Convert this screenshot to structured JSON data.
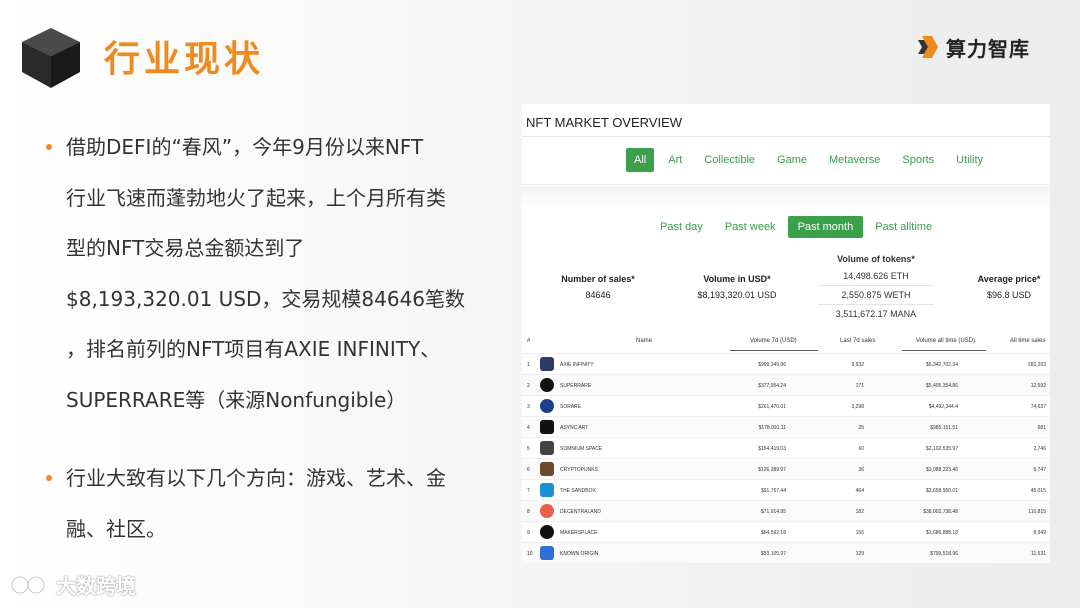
{
  "slide": {
    "title": "行业现状",
    "brand": "算力智库",
    "watermark": "大数跨境",
    "bullets": [
      {
        "lines": [
          "借助DEFI的“春风”，今年9月份以来NFT",
          "行业飞速而蓬勃地火了起来，上个月所有类",
          "型的NFT交易总金额达到了",
          "$8,193,320.01 USD，交易规模84646笔数",
          "，排名前列的NFT项目有AXIE INFINITY、",
          "SUPERRARE等（来源Nonfungible）"
        ]
      },
      {
        "lines": [
          "行业大致有以下几个方向：游戏、艺术、金",
          "融、社区。"
        ]
      }
    ]
  },
  "nft": {
    "title": "NFT MARKET OVERVIEW",
    "categories": [
      "All",
      "Art",
      "Collectible",
      "Game",
      "Metaverse",
      "Sports",
      "Utility"
    ],
    "active_category": "All",
    "periods": [
      "Past day",
      "Past week",
      "Past month",
      "Past alltime"
    ],
    "active_period": "Past month",
    "stats": {
      "sales_label": "Number of sales*",
      "sales_value": "84646",
      "volume_label": "Volume in USD*",
      "volume_value": "$8,193,320.01 USD",
      "tokens_label": "Volume of tokens*",
      "tokens_values": [
        "14,498.626 ETH",
        "2,550.875 WETH",
        "3,511,672.17 MANA"
      ],
      "avg_label": "Average price*",
      "avg_value": "$96.8 USD"
    },
    "table": {
      "headers": {
        "rank": "#",
        "name": "Name",
        "vol7": "Volume 7d (USD)",
        "sales7": "Last 7d sales",
        "volall": "Volume all time (USD)",
        "salesall": "All time sales"
      },
      "rows": [
        {
          "rank": "1",
          "name": "AXIE INFINITY",
          "vol7": "$999,349.86",
          "sales7": "9,932",
          "volall": "$6,342,702.34",
          "salesall": "281,293",
          "color": "#2b3a67"
        },
        {
          "rank": "2",
          "name": "SUPERRARE",
          "vol7": "$377,954.24",
          "sales7": "171",
          "volall": "$5,405,354.86",
          "salesall": "12,592",
          "color": "#111111"
        },
        {
          "rank": "3",
          "name": "SORARE",
          "vol7": "$261,470.01",
          "sales7": "3,298",
          "volall": "$4,492,344.4",
          "salesall": "74,637",
          "color": "#1d3f8a"
        },
        {
          "rank": "4",
          "name": "ASYNC ART",
          "vol7": "$178,091.11",
          "sales7": "25",
          "volall": "$985,151.51",
          "salesall": "681",
          "color": "#111111"
        },
        {
          "rank": "5",
          "name": "SOMNIUM SPACE",
          "vol7": "$154,419.03",
          "sales7": "60",
          "volall": "$2,102,535.97",
          "salesall": "2,746",
          "color": "#444444"
        },
        {
          "rank": "6",
          "name": "CRYPTOPUNKS",
          "vol7": "$126,389.97",
          "sales7": "36",
          "volall": "$3,088,223.46",
          "salesall": "5,747",
          "color": "#6b4a2b"
        },
        {
          "rank": "7",
          "name": "THE SANDBOX",
          "vol7": "$91,767.44",
          "sales7": "464",
          "volall": "$2,658,950.01",
          "salesall": "45,015",
          "color": "#1a8fd6"
        },
        {
          "rank": "8",
          "name": "DECENTRALAND",
          "vol7": "$71,914.95",
          "sales7": "182",
          "volall": "$38,002,738.48",
          "salesall": "110,815",
          "color": "#e8604c"
        },
        {
          "rank": "9",
          "name": "MAKERSPLACE",
          "vol7": "$64,592.18",
          "sales7": "156",
          "volall": "$1,686,888.18",
          "salesall": "8,949",
          "color": "#111111"
        },
        {
          "rank": "10",
          "name": "KNOWN ORIGIN",
          "vol7": "$53,105.97",
          "sales7": "129",
          "volall": "$799,518.96",
          "salesall": "11,631",
          "color": "#2f6fd8"
        }
      ]
    }
  },
  "colors": {
    "accent_orange": "#f08a1c",
    "accent_green": "#3aa04a"
  },
  "icons": [
    "cube-icon",
    "brand-logo-icon",
    "bullet-dot-icon",
    "watermark-logo-icon"
  ]
}
